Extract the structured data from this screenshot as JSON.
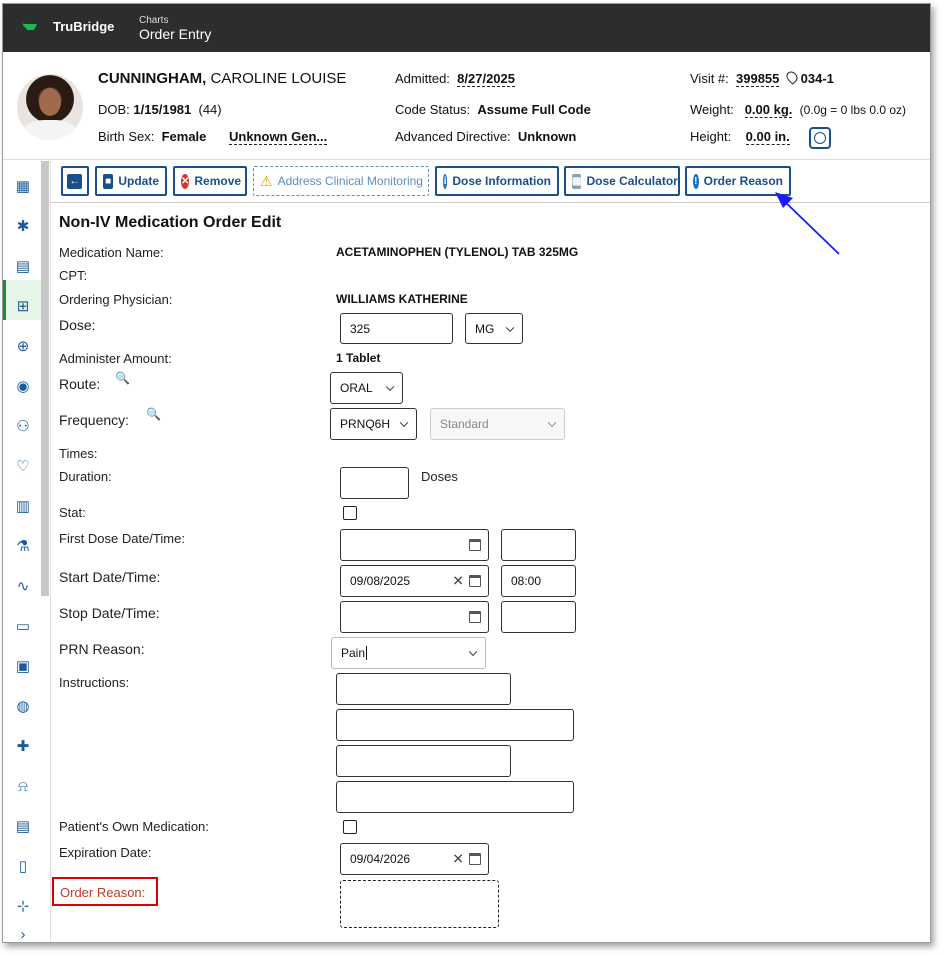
{
  "header": {
    "brand": "TruBridge",
    "crumb_small": "Charts",
    "crumb_main": "Order Entry"
  },
  "patient": {
    "last_name": "CUNNINGHAM,",
    "first_name": " CAROLINE LOUISE",
    "dob_label": "DOB:",
    "dob": "1/15/1981",
    "age": "(44)",
    "birth_sex_label": "Birth Sex:",
    "birth_sex": "Female",
    "gender": "Unknown Gen...",
    "admitted_label": "Admitted:",
    "admitted": "8/27/2025",
    "code_status_label": "Code Status:",
    "code_status": "Assume Full Code",
    "adv_dir_label": "Advanced Directive:",
    "adv_dir": "Unknown",
    "visit_label": "Visit #:",
    "visit": "399855",
    "room": "034-1",
    "weight_label": "Weight:",
    "weight": "0.00 kg.",
    "weight_extra": "(0.0g = 0 lbs 0.0 oz)",
    "height_label": "Height:",
    "height": "0.00 in."
  },
  "sidebar": {
    "icons": [
      "dashboard-icon",
      "star-of-life-icon",
      "document-icon",
      "monitor-plus-icon",
      "plus-clock-icon",
      "care-team-icon",
      "people-icon",
      "vitals-icon",
      "notes-icon",
      "flask-icon",
      "pulse-icon",
      "bed-icon",
      "pharmacy-icon",
      "globe-icon",
      "capsule-check-icon",
      "alarm-icon",
      "report-icon",
      "attachment-icon",
      "hierarchy-icon",
      "chevron-right-icon"
    ]
  },
  "toolbar": {
    "update": "Update",
    "remove": "Remove",
    "address": "Address Clinical Monitoring",
    "dose_info": "Dose Information",
    "dose_calc": "Dose Calculator",
    "order_reason": "Order Reason"
  },
  "form": {
    "title": "Non-IV Medication Order Edit",
    "med_name_label": "Medication Name:",
    "med_name": "ACETAMINOPHEN (TYLENOL) TAB 325MG",
    "cpt_label": "CPT:",
    "physician_label": "Ordering Physician:",
    "physician": "WILLIAMS KATHERINE",
    "dose_label": "Dose:",
    "dose_value": "325",
    "dose_unit": "MG",
    "admin_amount_label": "Administer Amount:",
    "admin_amount": "1 Tablet",
    "route_label": "Route:",
    "route_value": "ORAL",
    "frequency_label": "Frequency:",
    "frequency_value": "PRNQ6H",
    "frequency_type": "Standard",
    "times_label": "Times:",
    "duration_label": "Duration:",
    "duration_unit": "Doses",
    "stat_label": "Stat:",
    "first_dose_label": "First Dose Date/Time:",
    "start_label": "Start Date/Time:",
    "start_date": "09/08/2025",
    "start_time": "08:00",
    "stop_label": "Stop Date/Time:",
    "prn_label": "PRN Reason:",
    "prn_value": "Pain",
    "instructions_label": "Instructions:",
    "own_med_label": "Patient's Own Medication:",
    "expiration_label": "Expiration Date:",
    "expiration_value": "09/04/2026",
    "order_reason_label": "Order Reason:"
  }
}
